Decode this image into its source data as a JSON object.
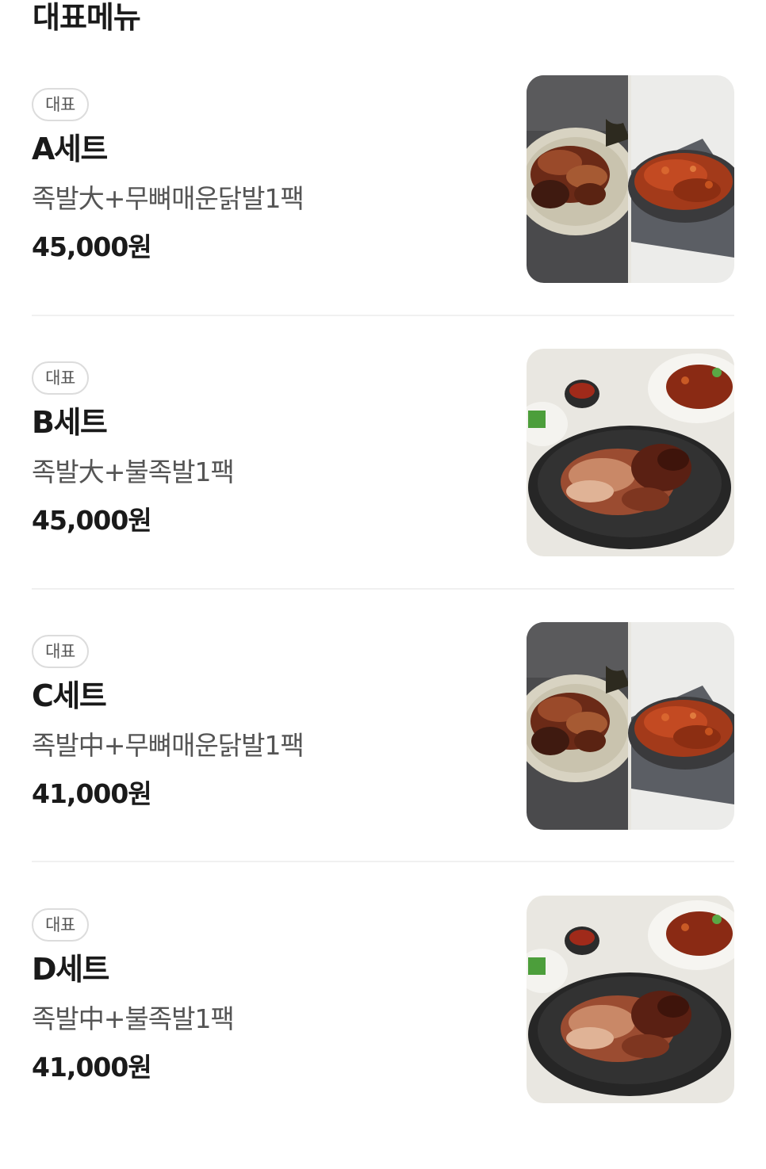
{
  "section": {
    "title": "대표메뉴"
  },
  "menu_items": [
    {
      "badge": "대표",
      "name": "A세트",
      "description": "족발大+무뼈매운닭발1팩",
      "price": "45,000원",
      "image_icon": "split-jokbal-dakbal-photo"
    },
    {
      "badge": "대표",
      "name": "B세트",
      "description": "족발大+불족발1팩",
      "price": "45,000원",
      "image_icon": "jokbal-platter-photo"
    },
    {
      "badge": "대표",
      "name": "C세트",
      "description": "족발中+무뼈매운닭발1팩",
      "price": "41,000원",
      "image_icon": "split-jokbal-dakbal-photo"
    },
    {
      "badge": "대표",
      "name": "D세트",
      "description": "족발中+불족발1팩",
      "price": "41,000원",
      "image_icon": "jokbal-platter-photo"
    }
  ]
}
